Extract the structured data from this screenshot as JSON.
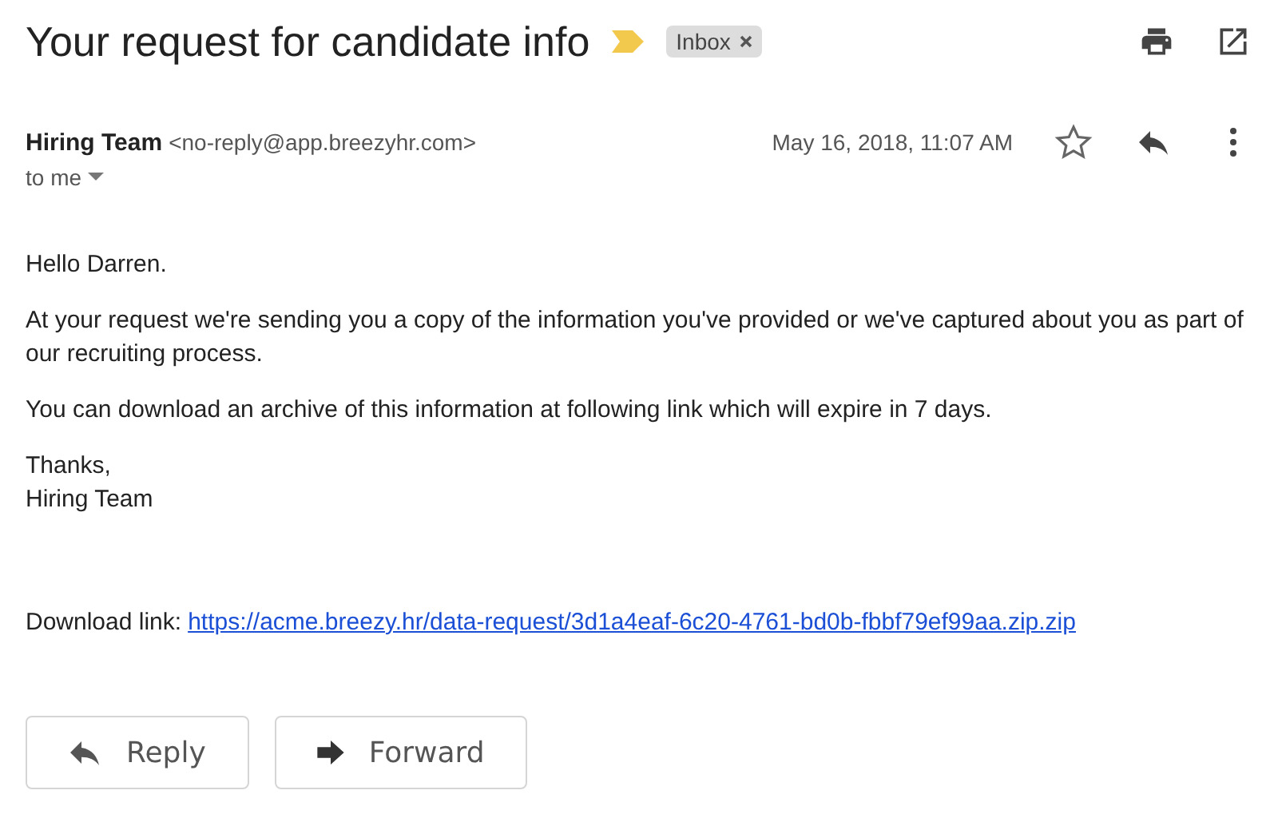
{
  "subject": "Your request for candidate info",
  "labels": [
    {
      "text": "Inbox"
    }
  ],
  "sender": {
    "name": "Hiring Team",
    "email": "<no-reply@app.breezyhr.com>",
    "date": "May 16, 2018, 11:07 AM",
    "starred": false,
    "recipient": "to me"
  },
  "body": {
    "greeting": "Hello Darren.",
    "paragraphs": [
      "At your request we're sending you a copy of the information you've provided or we've captured about you as part of our recruiting process.",
      "You can download an archive of this information at following link which will expire in 7 days."
    ],
    "signoff": [
      "Thanks,",
      "Hiring Team"
    ],
    "download_label": "Download link:",
    "download_link": "https://acme.breezy.hr/data-request/3d1a4eaf-6c20-4761-bd0b-fbbf79ef99aa.zip.zip"
  },
  "actions": [
    {
      "kind": "reply",
      "label": "Reply"
    },
    {
      "kind": "forward",
      "label": "Forward"
    }
  ]
}
